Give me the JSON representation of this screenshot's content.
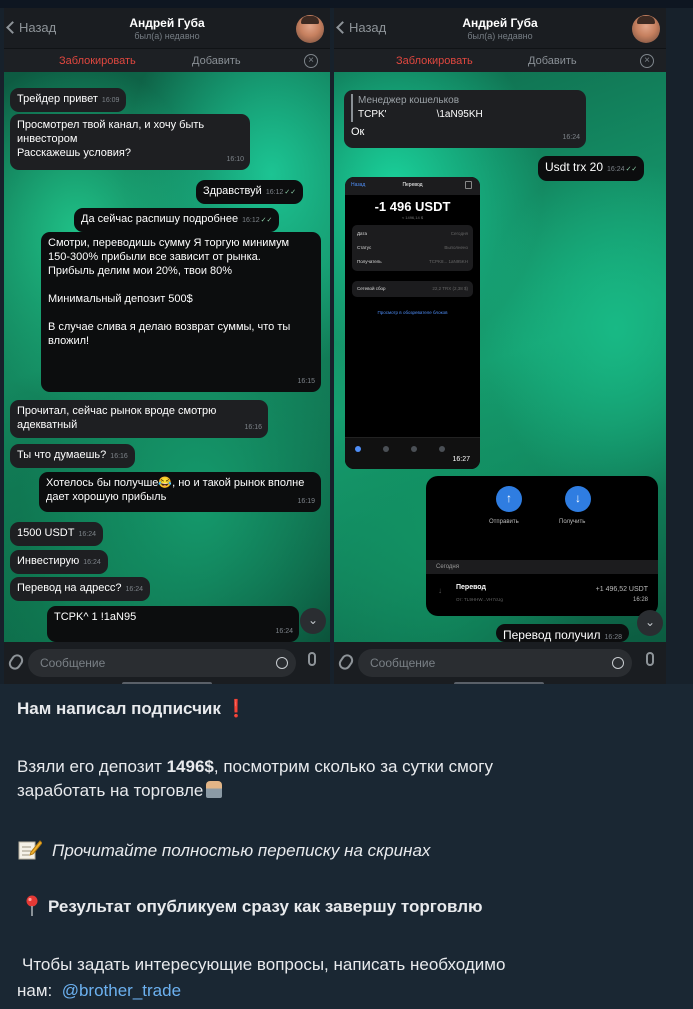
{
  "left_chat": {
    "back": "Назад",
    "contact_name": "Андрей Губа",
    "contact_status": "был(а) недавно",
    "block_label": "Заблокировать",
    "add_label": "Добавить",
    "input_placeholder": "Сообщение",
    "messages": [
      {
        "text": "Трейдер привет",
        "time": "16:09",
        "dir": "in"
      },
      {
        "text": "Просмотрел твой канал, и хочу быть инвестором\nРасскажешь условия?",
        "time": "16:10",
        "dir": "in"
      },
      {
        "text": "Здравствуй",
        "time": "16:12",
        "dir": "out"
      },
      {
        "text": "Да сейчас распишу подробнее",
        "time": "16:12",
        "dir": "out"
      },
      {
        "text": "Смотри, переводишь сумму Я торгую минимум 150-300% прибыли все зависит от рынка. Прибыль делим мои 20%, твои 80%\n\nМинимальный депозит 500$\n\nВ случае слива я делаю возврат суммы, что ты вложил!",
        "time": "16:15",
        "dir": "out"
      },
      {
        "text": "Прочитал, сейчас рынок вроде смотрю адекватный",
        "time": "16:16",
        "dir": "in"
      },
      {
        "text": "Ты что думаешь?",
        "time": "16:16",
        "dir": "in"
      },
      {
        "text": "Хотелось бы получше😂, но и такой рынок вполне дает хорошую прибыль",
        "time": "16:19",
        "dir": "out"
      },
      {
        "text": "1500 USDT",
        "time": "16:24",
        "dir": "in"
      },
      {
        "text": "Инвестирую",
        "time": "16:24",
        "dir": "in"
      },
      {
        "text": "Перевод на адресс?",
        "time": "16:24",
        "dir": "in"
      },
      {
        "text": "TCPK^                 1 !1aN95",
        "time": "16:24",
        "dir": "out"
      }
    ]
  },
  "right_chat": {
    "back": "Назад",
    "contact_name": "Андрей Губа",
    "contact_status": "был(а) недавно",
    "block_label": "Заблокировать",
    "add_label": "Добавить",
    "input_placeholder": "Сообщение",
    "reply_sender": "Менеджер кошельков",
    "reply_text": "TCPK'                  \\1aN95KH",
    "reply_message": "Ок",
    "reply_time": "16:24",
    "msg_usdt": "Usdt trx 20",
    "msg_usdt_time": "16:24",
    "inner": {
      "back": "Назад",
      "title": "Перевод",
      "amount": "-1 496 USDT",
      "amount_sub": "≈ 1496,14 $",
      "rows": [
        "Дата",
        "Статус",
        "Получатель"
      ],
      "row_values": [
        "Сегодня",
        "Выполнено",
        "TCPK8... 1aN95KH"
      ],
      "fee_label": "Сетевой сбор",
      "fee_value": "22,2 TRX (2,38 $)",
      "explorer": "Просмотр в обозревателе блоков",
      "time": "16:27"
    },
    "wallet": {
      "send": "Отправить",
      "receive": "Получить",
      "section": "Сегодня",
      "tx_title": "Перевод",
      "tx_from": "От: TL9HHW...VH7cUg",
      "tx_amount": "+1 496,52 USDT",
      "tx_time": "16:28"
    },
    "msg_received": "Перевод получил",
    "msg_received_time": "16:28"
  },
  "caption": {
    "line1": "Нам написал подписчик",
    "line2_a": "Взяли его депозит ",
    "line2_bold": "1496$",
    "line2_b": ", посмотрим сколько за сутки смогу",
    "line3": "заработать на торговле",
    "line4": "Прочитайте полностью переписку на скринах",
    "line5": "Результат опубликуем сразу как завершу торговлю",
    "line6": "Чтобы задать интересующие вопросы, написать необходимо",
    "line7_a": "нам:",
    "line7_link": "@brother_trade"
  },
  "icons": [
    "back-chevron-icon",
    "close-circle-icon",
    "paperclip-icon",
    "sticker-icon",
    "microphone-icon",
    "scroll-down-icon",
    "red-exclamation-icon",
    "man-technologist-icon",
    "memo-icon",
    "pushpin-icon"
  ],
  "colors": {
    "block_red": "#e0473f",
    "link_blue": "#6cb1f0",
    "caption_bg": "#1a2733"
  }
}
